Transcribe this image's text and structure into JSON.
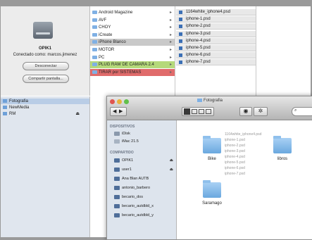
{
  "server": {
    "name": "OPIK1",
    "status": "Conectado como: marcos.jimenez",
    "disconnect_label": "Desconectar",
    "share_label": "Compartir pantalla..."
  },
  "server_sidebar": [
    "Fotografia",
    "NewMedia",
    "RM"
  ],
  "column2": [
    {
      "label": "Android Magazine"
    },
    {
      "label": "AVF"
    },
    {
      "label": "CHOY"
    },
    {
      "label": "iCreate"
    },
    {
      "label": "iPhone Blanco",
      "selected": true
    },
    {
      "label": "MOTOR"
    },
    {
      "label": "PC"
    },
    {
      "label": "PLUG RAW DE CAMARA 2.4",
      "tag": "#b5d97a"
    },
    {
      "label": "TIRAR por SISTEMAS",
      "tag": "#e06b6b"
    }
  ],
  "column3": [
    "1164white_iphone4.psd",
    "iphone-1.psd",
    "iphone-2.psd",
    "iphone-3.psd",
    "iphone-4.psd",
    "iphone-5.psd",
    "iphone-6.psd",
    "iphone-7.psd"
  ],
  "finder": {
    "title": "Fotografia",
    "dispositivos_header": "DISPOSITIVOS",
    "devices": [
      "iDisk",
      "iMac 21.5"
    ],
    "compartido_header": "COMPARTIDO",
    "shared": [
      "OPIK1",
      "user1",
      "Ana Blan AUTB",
      "antonio_barbero",
      "becario_dos",
      "becario_autdbld_x",
      "becario_autdbld_y"
    ],
    "folders": [
      "Bike",
      "libros",
      "Saramago"
    ],
    "files": [
      "1164white_iphone4.psd",
      "iphone-1.psd",
      "iphone-2.psd",
      "iphone-3.psd",
      "iphone-4.psd",
      "iphone-5.psd",
      "iphone-6.psd",
      "iphone-7.psd"
    ]
  }
}
